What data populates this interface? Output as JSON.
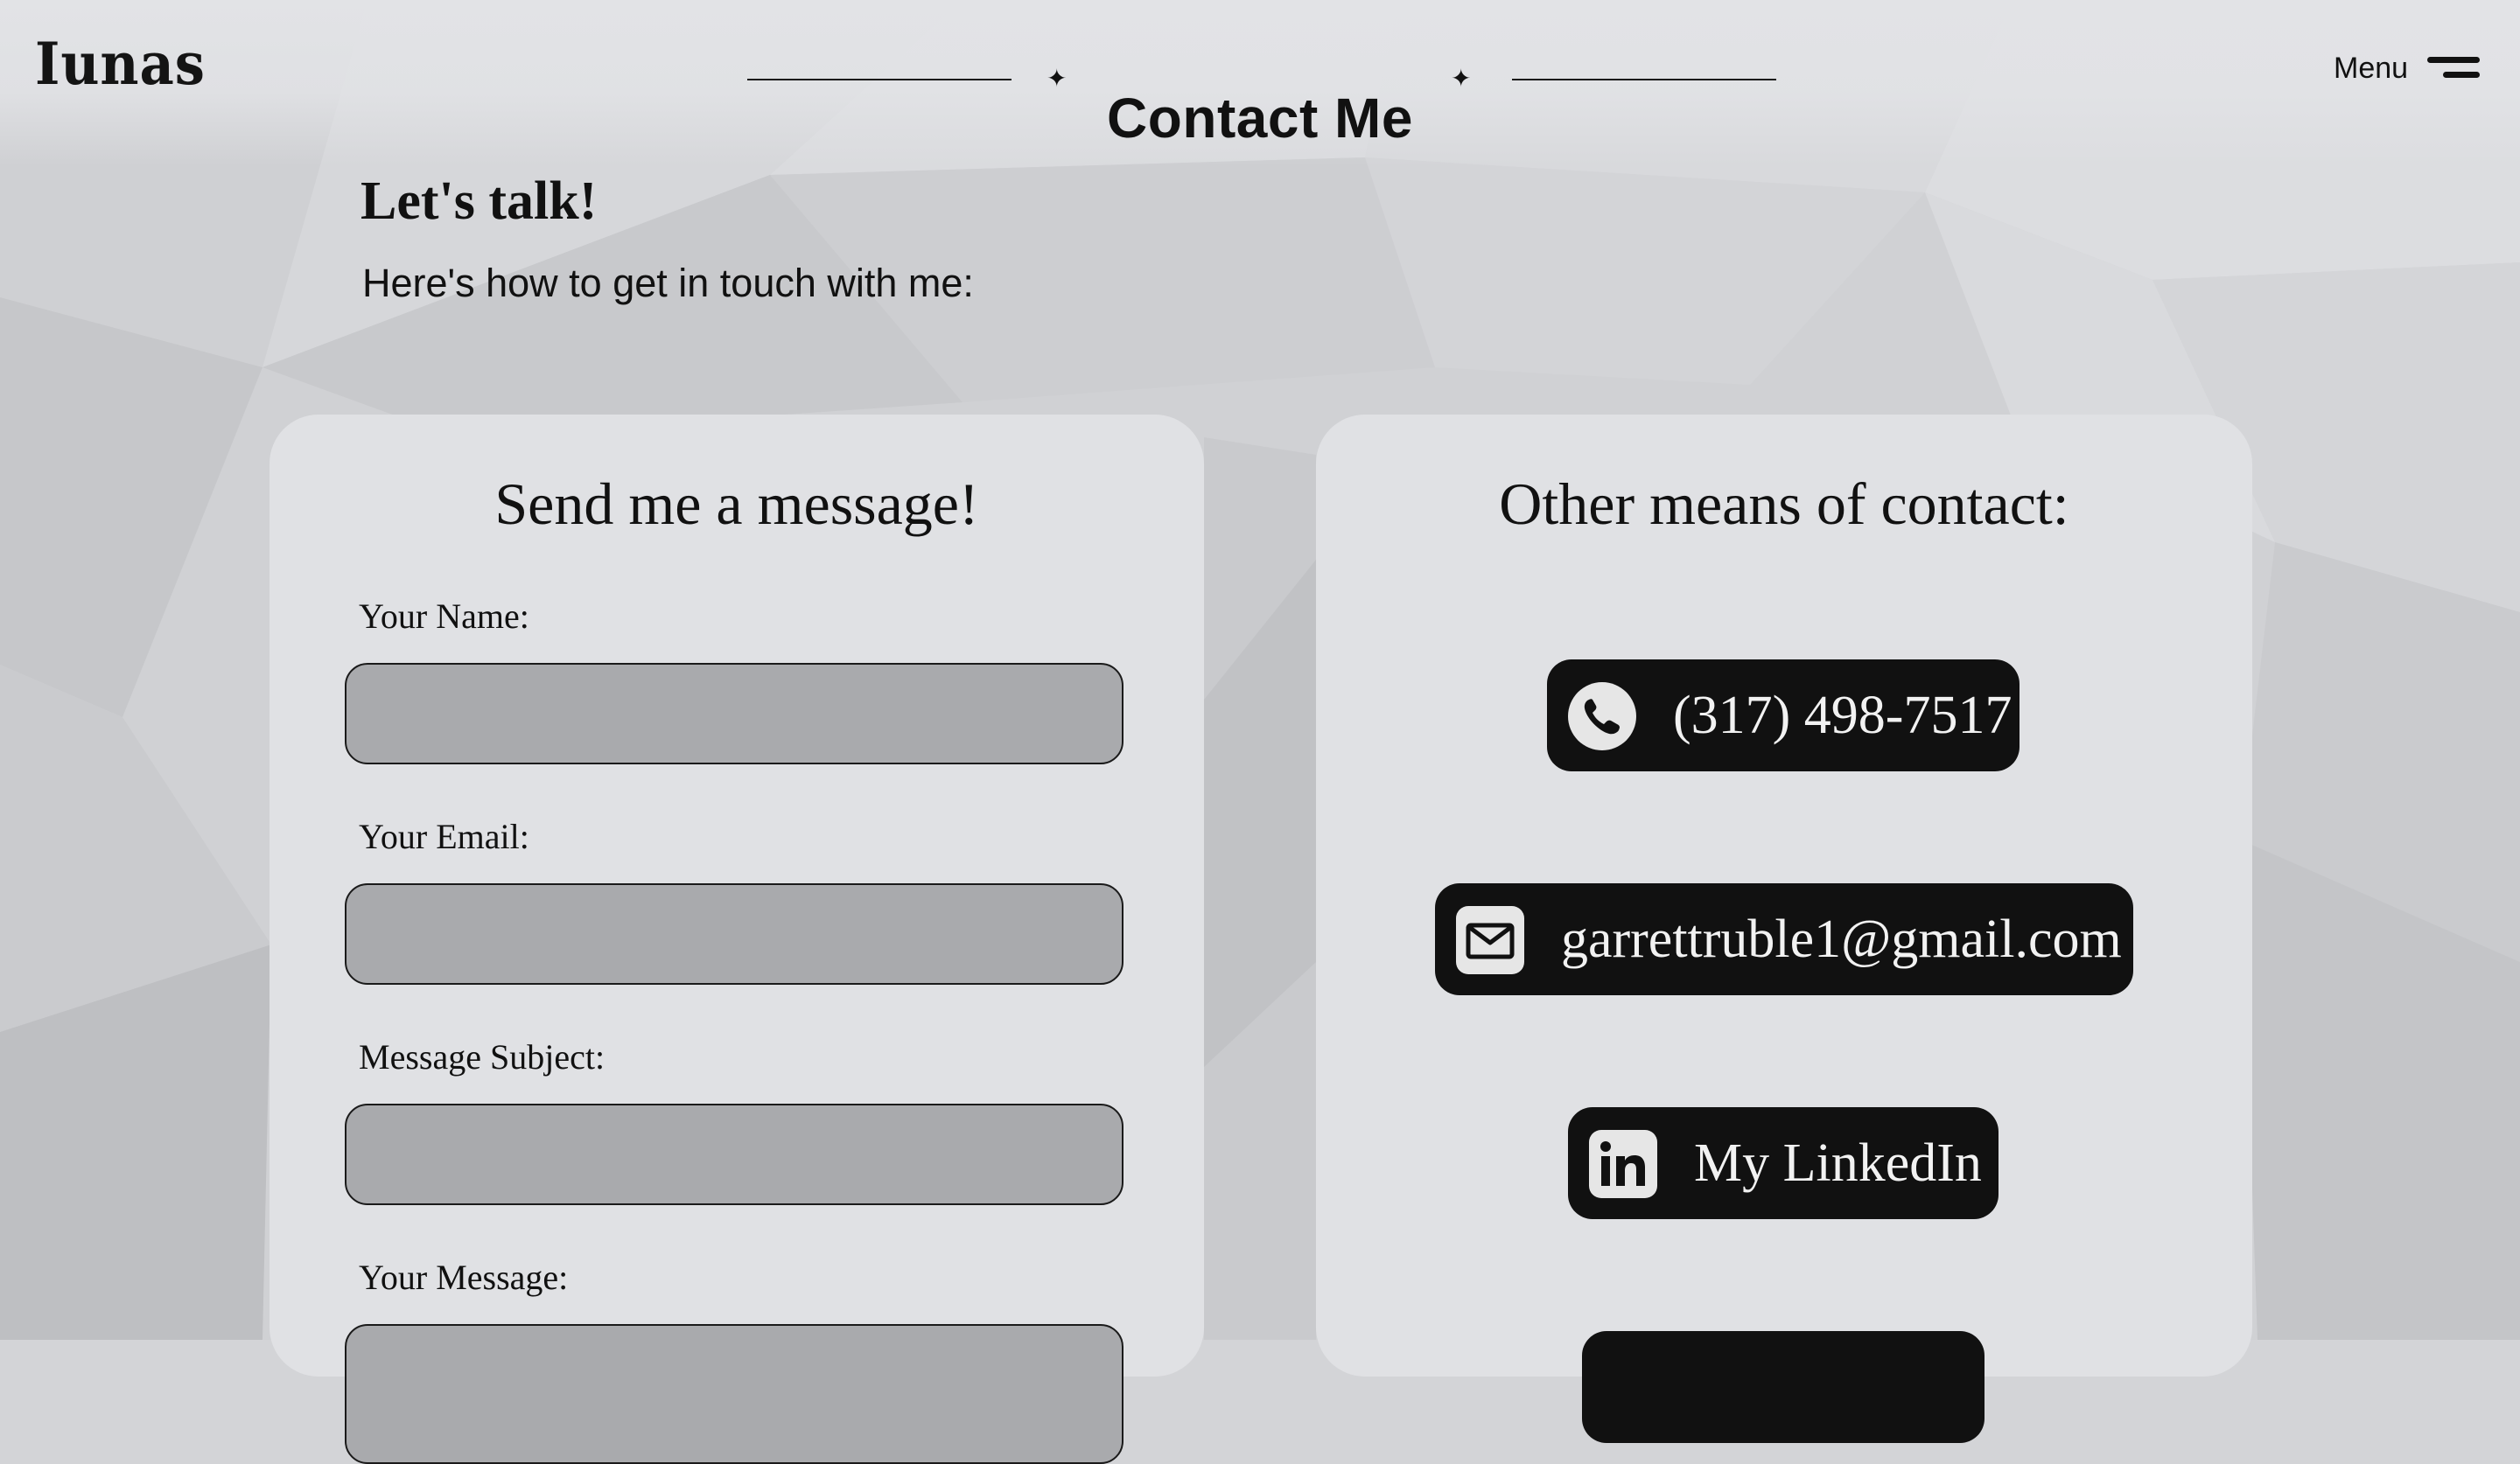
{
  "header": {
    "logo_text": "Iunas",
    "page_title": "Contact Me",
    "menu_label": "Menu"
  },
  "intro": {
    "heading": "Let's talk!",
    "subtext": "Here's how to get in touch with me:"
  },
  "form_card": {
    "title": "Send me a message!",
    "fields": [
      {
        "label": "Your Name:",
        "value": ""
      },
      {
        "label": "Your Email:",
        "value": ""
      },
      {
        "label": "Message Subject:",
        "value": ""
      },
      {
        "label": "Your Message:",
        "value": ""
      }
    ]
  },
  "contact_card": {
    "title": "Other means of contact:",
    "items": [
      {
        "icon": "phone-icon",
        "text": "(317) 498-7517"
      },
      {
        "icon": "email-icon",
        "text": "garrettruble1@gmail.com"
      },
      {
        "icon": "linkedin-icon",
        "text": "My LinkedIn"
      }
    ]
  },
  "colors": {
    "background": "#d3d4d7",
    "card": "#e0e1e4",
    "input_fill": "#a9aaad",
    "button": "#111111",
    "button_text": "#f2f2f2"
  }
}
